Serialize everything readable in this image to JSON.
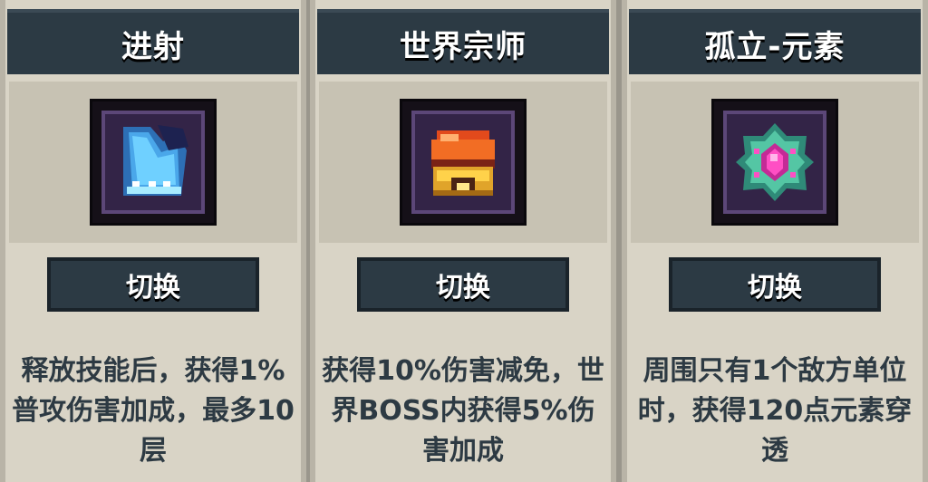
{
  "cards": [
    {
      "title": "进射",
      "icon": "ice-crystal-icon",
      "button_label": "切换",
      "description": "释放技能后，获得1%普攻伤害加成，最多10层"
    },
    {
      "title": "世界宗师",
      "icon": "golden-helmet-icon",
      "button_label": "切换",
      "description": "获得10%伤害减免，世界BOSS内获得5%伤害加成"
    },
    {
      "title": "孤立-元素",
      "icon": "pink-gem-icon",
      "button_label": "切换",
      "description": "周围只有1个敌方单位时，获得120点元素穿透"
    }
  ],
  "colors": {
    "header_bg": "#2c3a44",
    "card_bg": "#d9d4c6",
    "text_dark": "#2d3a43"
  }
}
